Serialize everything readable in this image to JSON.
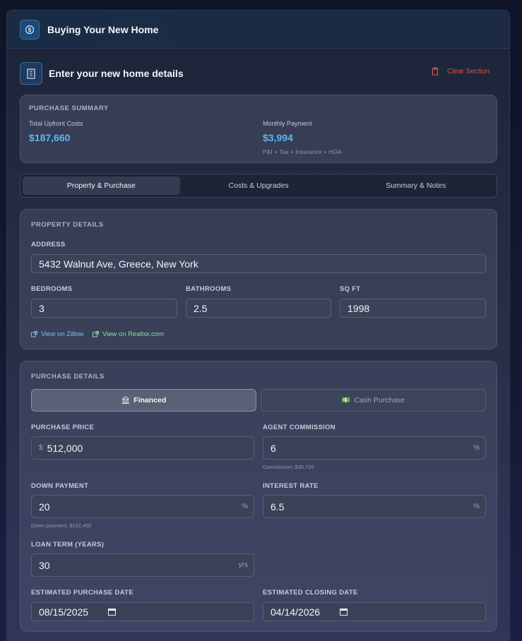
{
  "window": {
    "title": "Buying Your New Home"
  },
  "section": {
    "title": "Enter your new home details",
    "clear_label": "Clear Section"
  },
  "summary": {
    "heading": "PURCHASE SUMMARY",
    "upfront_label": "Total Upfront Costs",
    "upfront_value": "$187,660",
    "monthly_label": "Monthly Payment",
    "monthly_value": "$3,994",
    "monthly_note": "P&I + Tax + Insurance + HOA"
  },
  "tabs": [
    {
      "label": "Property & Purchase",
      "active": true
    },
    {
      "label": "Costs & Upgrades",
      "active": false
    },
    {
      "label": "Summary & Notes",
      "active": false
    }
  ],
  "property": {
    "heading": "PROPERTY DETAILS",
    "address_label": "ADDRESS",
    "address_value": "5432 Walnut Ave, Greece, New York",
    "bedrooms_label": "BEDROOMS",
    "bedrooms_value": "3",
    "bathrooms_label": "BATHROOMS",
    "bathrooms_value": "2.5",
    "sqft_label": "SQ FT",
    "sqft_value": "1998",
    "zillow_link": "View on Zillow",
    "realtor_link": "View on Realtor.com"
  },
  "purchase": {
    "heading": "PURCHASE DETAILS",
    "financed_label": "Financed",
    "cash_label": "Cash Purchase",
    "price_label": "PURCHASE PRICE",
    "price_prefix": "$",
    "price_value": "512,000",
    "commission_label": "AGENT COMMISSION",
    "commission_value": "6",
    "commission_unit": "%",
    "commission_hint": "Commission: $30,720",
    "down_label": "DOWN PAYMENT",
    "down_value": "20",
    "down_unit": "%",
    "down_hint": "Down payment: $102,400",
    "rate_label": "INTEREST RATE",
    "rate_value": "6.5",
    "rate_unit": "%",
    "term_label": "LOAN TERM (YEARS)",
    "term_value": "30",
    "term_unit": "yrs",
    "purchase_date_label": "ESTIMATED PURCHASE DATE",
    "purchase_date_value": "08/15/2025",
    "closing_date_label": "ESTIMATED CLOSING DATE",
    "closing_date_value": "04/14/2026"
  },
  "colors": {
    "accent": "#5ab8f0",
    "danger": "#d9534f",
    "link_zillow": "#6ec6f5",
    "link_realtor": "#7fe0a8"
  }
}
